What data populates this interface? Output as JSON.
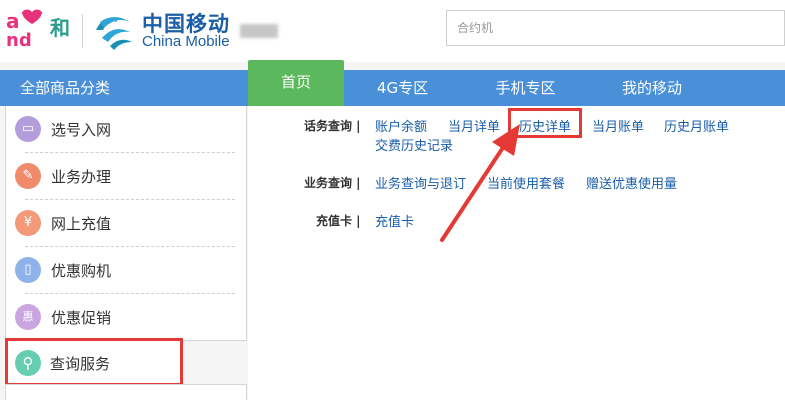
{
  "header": {
    "logo_and_text": "and",
    "logo_he": "和",
    "brand_cn": "中国移动",
    "brand_en": "China Mobile",
    "search_placeholder": "合约机"
  },
  "nav": {
    "category_title": "全部商品分类",
    "tabs": [
      "首页",
      "4G专区",
      "手机专区",
      "我的移动"
    ],
    "active_tab": "首页"
  },
  "sidebar": {
    "items": [
      {
        "label": "选号入网",
        "icon_glyph": "▭",
        "icon_name": "sim-card-icon",
        "color": "#b39ddb"
      },
      {
        "label": "业务办理",
        "icon_glyph": "✎",
        "icon_name": "pencil-icon",
        "color": "#f08a6c"
      },
      {
        "label": "网上充值",
        "icon_glyph": "¥",
        "icon_name": "yen-icon",
        "color": "#f29a7a"
      },
      {
        "label": "优惠购机",
        "icon_glyph": "▯",
        "icon_name": "phone-icon",
        "color": "#8fb3e8"
      },
      {
        "label": "优惠促销",
        "icon_glyph": "惠",
        "icon_name": "promo-icon",
        "color": "#c9a6e0"
      },
      {
        "label": "查询服务",
        "icon_glyph": "⚲",
        "icon_name": "search-icon",
        "color": "#66cdb0"
      }
    ]
  },
  "main": {
    "sections": [
      {
        "label": "话务查询 |",
        "links": [
          "账户余额",
          "当月详单",
          "历史详单",
          "当月账单",
          "历史月账单",
          "交费历史记录"
        ]
      },
      {
        "label": "业务查询 |",
        "links": [
          "业务查询与退订",
          "当前使用套餐",
          "赠送优惠使用量"
        ]
      },
      {
        "label": "充值卡 |",
        "links": [
          "充值卡"
        ]
      }
    ]
  },
  "colors": {
    "nav_blue": "#4a90d9",
    "active_green": "#5cb85c",
    "highlight_red": "#e53935",
    "link_blue": "#1a5ea8"
  }
}
